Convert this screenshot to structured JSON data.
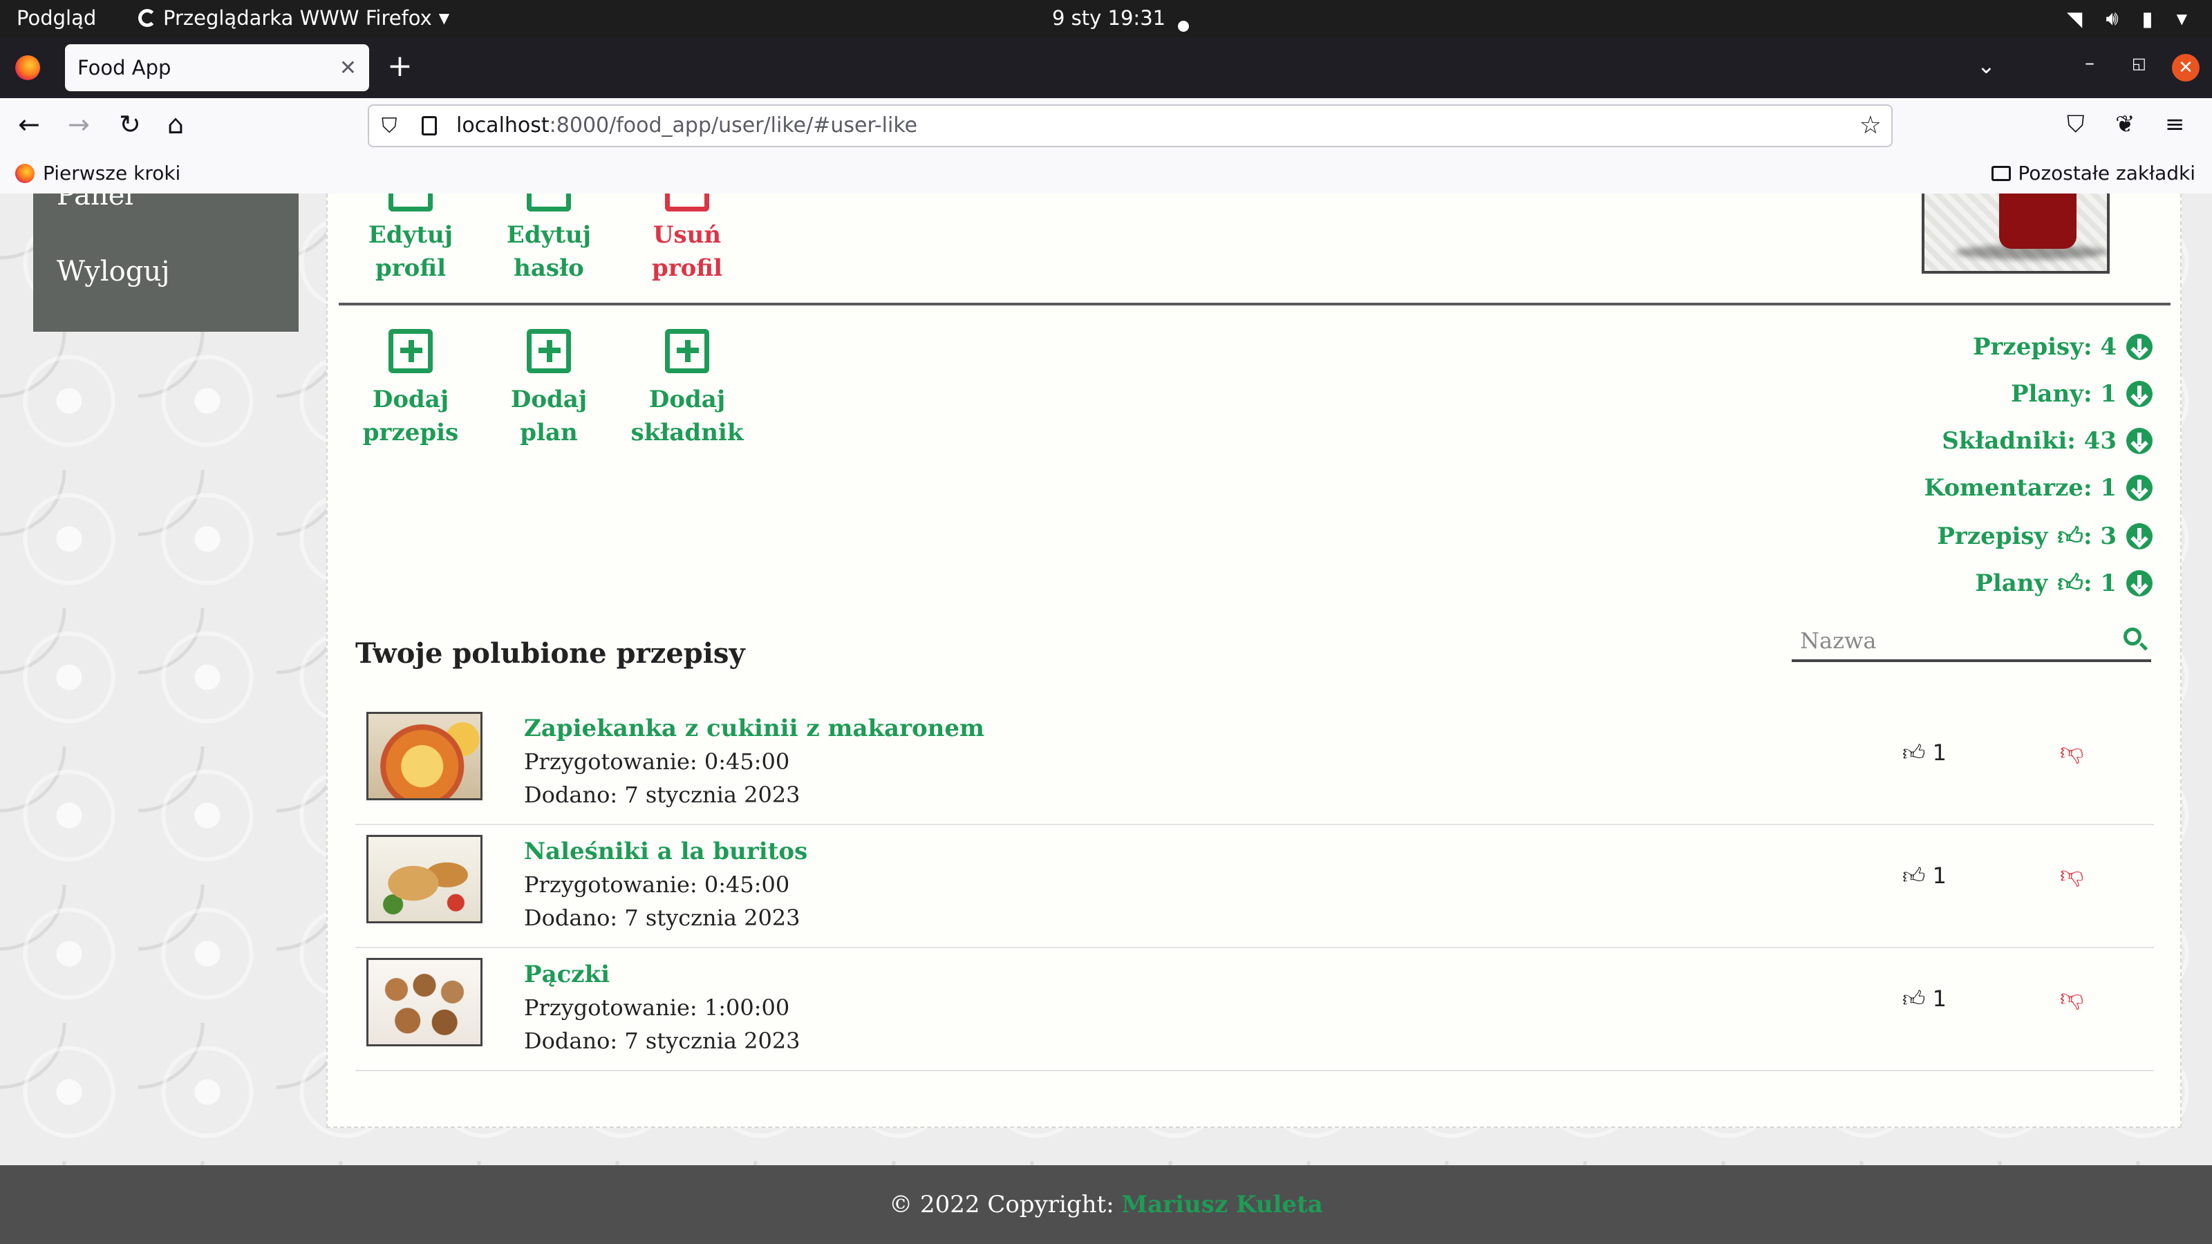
{
  "os_bar": {
    "activities": "Podgląd",
    "app_menu": "Przeglądarka WWW Firefox",
    "clock": "9 sty  19:31"
  },
  "browser": {
    "tab_title": "Food App",
    "url_host": "localhost",
    "url_path": ":8000/food_app/user/like/#user-like",
    "bookmark_left": "Pierwsze kroki",
    "bookmark_right": "Pozostałe zakładki"
  },
  "sidebar": {
    "partial_item": "Panel",
    "logout": "Wyloguj"
  },
  "profile_actions": [
    {
      "line1": "Edytuj",
      "line2": "profil"
    },
    {
      "line1": "Edytuj",
      "line2": "hasło"
    },
    {
      "line1": "Usuń",
      "line2": "profil"
    }
  ],
  "add_actions": [
    {
      "line1": "Dodaj",
      "line2": "przepis"
    },
    {
      "line1": "Dodaj",
      "line2": "plan"
    },
    {
      "line1": "Dodaj",
      "line2": "składnik"
    }
  ],
  "stats": [
    {
      "label": "Przepisy: 4",
      "thumb": false
    },
    {
      "label": "Plany: 1",
      "thumb": false
    },
    {
      "label": "Składniki: 43",
      "thumb": false
    },
    {
      "label": "Komentarze: 1",
      "thumb": false
    },
    {
      "label": "Przepisy",
      "suffix": ": 3",
      "thumb": true
    },
    {
      "label": "Plany",
      "suffix": ": 1",
      "thumb": true
    }
  ],
  "liked": {
    "title": "Twoje polubione przepisy",
    "search_placeholder": "Nazwa",
    "recipes": [
      {
        "name": "Zapiekanka z cukinii z makaronem",
        "prep": "Przygotowanie: 0:45:00",
        "added": "Dodano: 7 stycznia 2023",
        "likes": "1"
      },
      {
        "name": "Naleśniki a la buritos",
        "prep": "Przygotowanie: 0:45:00",
        "added": "Dodano: 7 stycznia 2023",
        "likes": "1"
      },
      {
        "name": "Pączki",
        "prep": "Przygotowanie: 1:00:00",
        "added": "Dodano: 7 stycznia 2023",
        "likes": "1"
      }
    ]
  },
  "footer": {
    "copyright": "© 2022 Copyright:",
    "author": "Mariusz Kuleta"
  },
  "colors": {
    "accent_green": "#1e9b57",
    "danger_red": "#dc3545",
    "sidebar_bg": "#5f6461",
    "footer_bg": "#4f4f4f"
  }
}
